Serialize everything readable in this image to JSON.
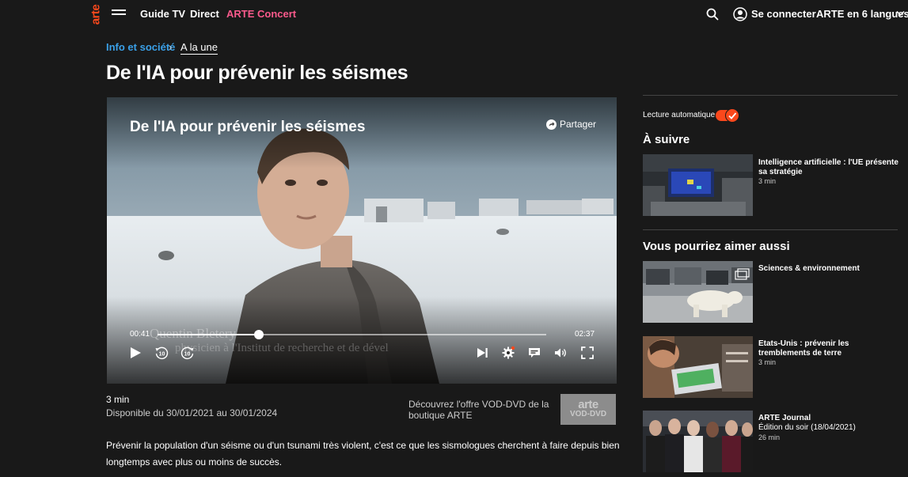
{
  "nav": {
    "logo": "arte",
    "items": [
      {
        "label": "Guide TV"
      },
      {
        "label": "Direct"
      },
      {
        "label": "ARTE Concert"
      }
    ],
    "login_label": "Se connecter",
    "language_label": "ARTE en 6 langues"
  },
  "breadcrumb": {
    "section": "Info et société",
    "separator": "›",
    "current": "A la une"
  },
  "page_title": "De l'IA pour prévenir les séismes",
  "player": {
    "title": "De l'IA pour prévenir les séismes",
    "share_label": "Partager",
    "current_time": "00:41",
    "total_time": "02:37",
    "progress_fraction": 0.261,
    "caption_name": "Quentin Bletery",
    "caption_role": "physicien à l'Institut de recherche et de dével",
    "skip_back_label": "10",
    "skip_forward_label": "10"
  },
  "info": {
    "duration": "3 min",
    "availability": "Disponible du 30/01/2021 au 30/01/2024",
    "vod_text": "Découvrez l'offre VOD-DVD de la boutique ARTE",
    "vod_logo_top": "arte",
    "vod_logo_bottom": "VOD-DVD"
  },
  "description": "Prévenir la population d'un séisme ou d'un tsunami très violent, c'est ce que les sismologues cherchent à faire depuis bien longtemps avec plus ou moins de succès.",
  "sidebar": {
    "autoplay_label": "Lecture automatique",
    "autoplay_on": true,
    "next_title": "À suivre",
    "next_items": [
      {
        "title": "Intelligence artificielle : l'UE présente sa stratégie",
        "meta": "3 min"
      }
    ],
    "related_title": "Vous pourriez aimer aussi",
    "related_items": [
      {
        "title": "Sciences & environnement",
        "subtitle": "",
        "meta": ""
      },
      {
        "title": "Etats-Unis : prévenir les tremblements de terre",
        "subtitle": "",
        "meta": "3 min"
      },
      {
        "title": "ARTE Journal",
        "subtitle": "Édition du soir (18/04/2021)",
        "meta": "26 min"
      }
    ]
  },
  "colors": {
    "background": "#191919",
    "brand": "#fa481c",
    "link": "#3aa0e8",
    "concert": "#fa5a8c"
  }
}
